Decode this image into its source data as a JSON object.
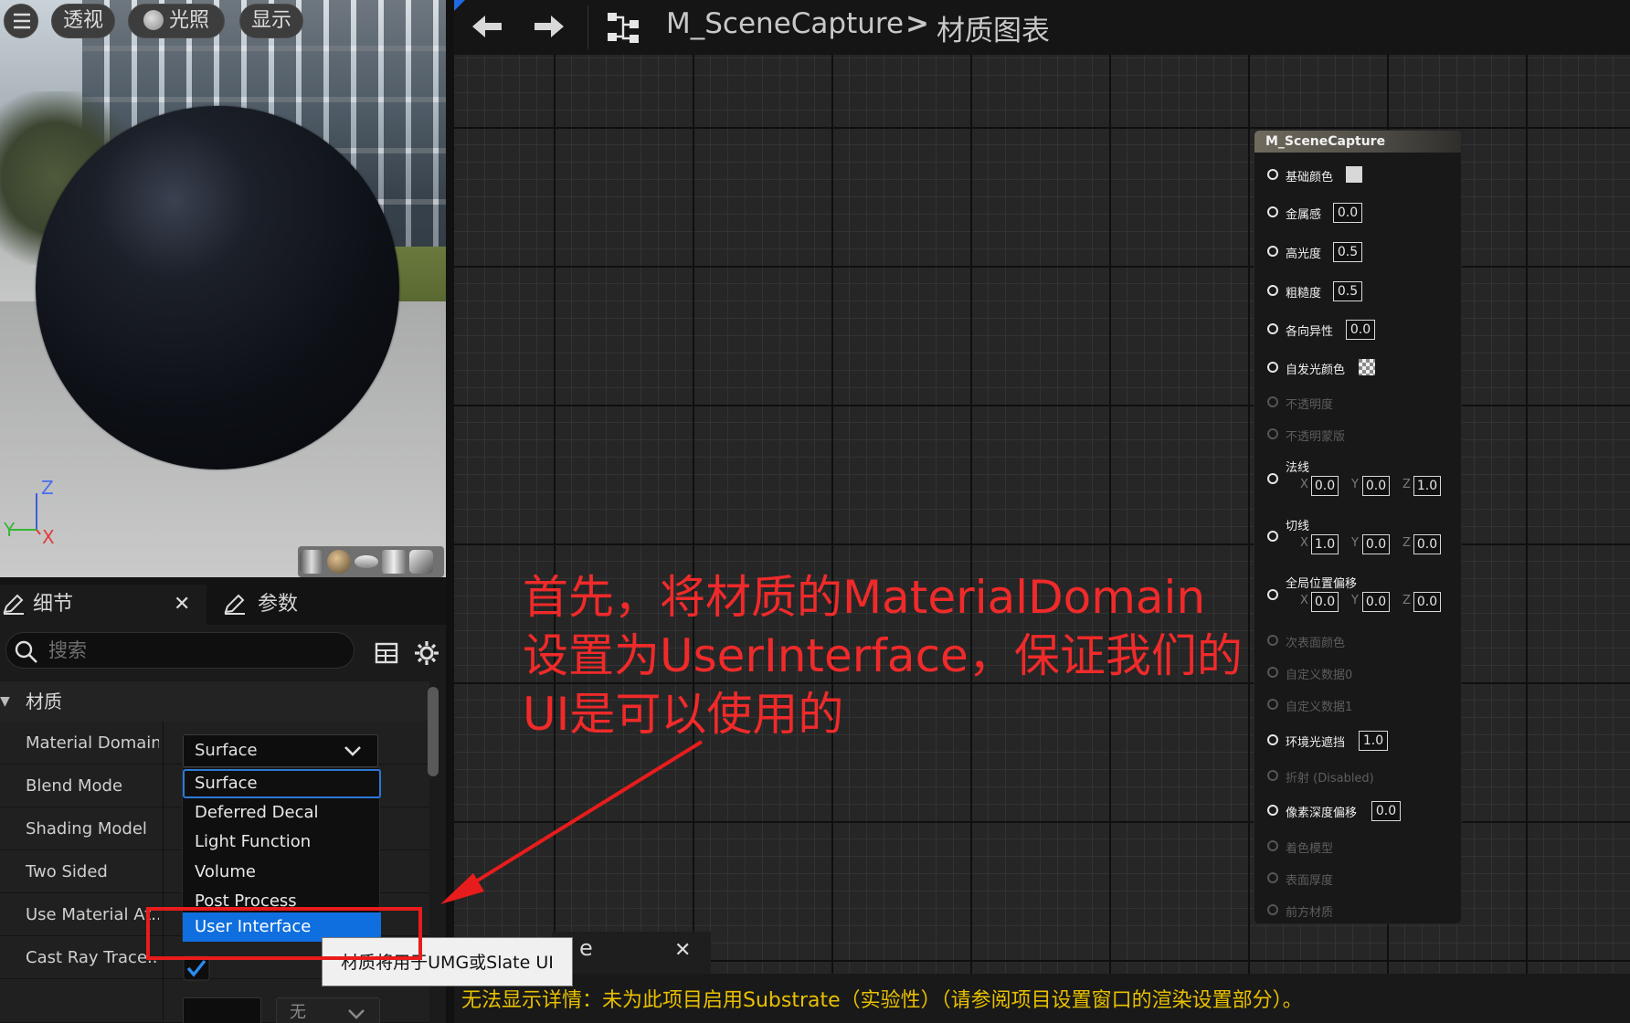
{
  "viewport": {
    "menu_icon": "hamburger-icon",
    "buttons": {
      "perspective": "透视",
      "lit": "光照",
      "show": "显示"
    },
    "axis_labels": {
      "z": "Z",
      "y": "Y",
      "x": "X"
    }
  },
  "details_panel": {
    "tabs": {
      "details": "细节",
      "parameters": "参数"
    },
    "search_placeholder": "搜索",
    "category": "材质",
    "properties": [
      {
        "label": "Material Domain"
      },
      {
        "label": "Blend Mode"
      },
      {
        "label": "Shading Model"
      },
      {
        "label": "Two Sided"
      },
      {
        "label": "Use Material At..."
      },
      {
        "label": "Cast Ray Trace..."
      }
    ],
    "material_domain_value": "Surface",
    "dropdown_options": [
      "Surface",
      "Deferred Decal",
      "Light Function",
      "Volume",
      "Post Process",
      "User Interface"
    ],
    "selected_option": "User Interface",
    "tooltip": "材质将用于UMG或Slate UI",
    "low_select": "无"
  },
  "graph": {
    "breadcrumb": {
      "asset": "M_SceneCapture",
      "separator": ">",
      "page": "材质图表"
    },
    "node": {
      "title": "M_SceneCapture",
      "pins": [
        {
          "label": "基础颜色",
          "value": "",
          "enabled": true
        },
        {
          "label": "金属感",
          "value": "0.0",
          "enabled": true
        },
        {
          "label": "高光度",
          "value": "0.5",
          "enabled": true
        },
        {
          "label": "粗糙度",
          "value": "0.5",
          "enabled": true
        },
        {
          "label": "各向异性",
          "value": "0.0",
          "enabled": true
        },
        {
          "label": "自发光颜色",
          "value": "",
          "enabled": true
        },
        {
          "label": "不透明度",
          "value": "",
          "enabled": false
        },
        {
          "label": "不透明蒙版",
          "value": "",
          "enabled": false
        },
        {
          "label": "法线",
          "x": "0.0",
          "y": "0.0",
          "z": "1.0",
          "enabled": true
        },
        {
          "label": "切线",
          "x": "1.0",
          "y": "0.0",
          "z": "0.0",
          "enabled": true
        },
        {
          "label": "全局位置偏移",
          "x": "0.0",
          "y": "0.0",
          "z": "0.0",
          "enabled": true
        },
        {
          "label": "次表面颜色",
          "value": "",
          "enabled": false
        },
        {
          "label": "自定义数据0",
          "value": "",
          "enabled": false
        },
        {
          "label": "自定义数据1",
          "value": "",
          "enabled": false
        },
        {
          "label": "环境光遮挡",
          "value": "1.0",
          "enabled": true
        },
        {
          "label": "折射 (Disabled)",
          "value": "",
          "enabled": false
        },
        {
          "label": "像素深度偏移",
          "value": "0.0",
          "enabled": true
        },
        {
          "label": "着色模型",
          "value": "",
          "enabled": false
        },
        {
          "label": "表面厚度",
          "value": "",
          "enabled": false
        },
        {
          "label": "前方材质",
          "value": "",
          "enabled": false
        }
      ],
      "axis": {
        "x": "X",
        "y": "Y",
        "z": "Z"
      }
    }
  },
  "annotation": {
    "line1": "首先，将材质的MaterialDomain",
    "line2": "设置为UserInterface，保证我们的",
    "line3": "UI是可以使用的",
    "color": "#f02a2a"
  },
  "bottom_panel": {
    "tab_suffix": "e",
    "message": "无法显示详情：未为此项目启用Substrate（实验性）（请参阅项目设置窗口的渲染设置部分）。",
    "message_color": "#e8c000"
  }
}
